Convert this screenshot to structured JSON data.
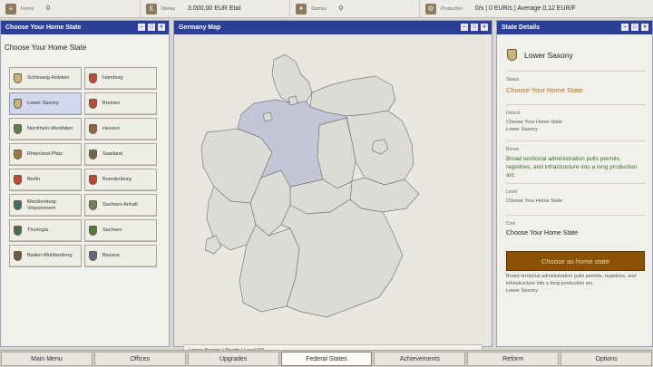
{
  "resources": [
    {
      "label": "Forms",
      "value": "0",
      "icon": "document-icon"
    },
    {
      "label": "Money",
      "value": "3.000,00 EUR Etat",
      "icon": "money-icon"
    },
    {
      "label": "Stamps",
      "value": "0",
      "icon": "stamp-icon"
    },
    {
      "label": "Production",
      "value": "0/s | 0 EUR/s | Average 0,12 EUR/F",
      "icon": "production-icon"
    }
  ],
  "left_panel": {
    "title": "Choose Your Home State",
    "heading": "Choose Your Home State",
    "states": [
      {
        "label": "Schleswig-Holstein",
        "color": "#c9b37a"
      },
      {
        "label": "Hamburg",
        "color": "#b94b3a"
      },
      {
        "label": "Lower Saxony",
        "color": "#c9b37a"
      },
      {
        "label": "Bremen",
        "color": "#b94b3a"
      },
      {
        "label": "Nordrhein-Westfalen",
        "color": "#5a7f4d"
      },
      {
        "label": "Hessen",
        "color": "#8a6a45"
      },
      {
        "label": "Rheinland-Pfalz",
        "color": "#9a7a45"
      },
      {
        "label": "Saarland",
        "color": "#6e6a4f"
      },
      {
        "label": "Berlin",
        "color": "#b94b3a"
      },
      {
        "label": "Brandenburg",
        "color": "#b94b3a"
      },
      {
        "label": "Mecklenburg-Vorpommern",
        "color": "#3d6e62"
      },
      {
        "label": "Sachsen-Anhalt",
        "color": "#7b7a58"
      },
      {
        "label": "Thuringia",
        "color": "#4d6d52"
      },
      {
        "label": "Sachsen",
        "color": "#5a7a45"
      },
      {
        "label": "Baden-Württemberg",
        "color": "#6b5b45"
      },
      {
        "label": "Bavaria",
        "color": "#5b6d7a"
      }
    ]
  },
  "center_panel": {
    "title": "Germany Map",
    "status": "Lower Saxony | Ready | Level 0/3"
  },
  "right_panel": {
    "title": "State Details",
    "state_name": "Lower Saxony",
    "status_label": "Status",
    "status_value": "Choose Your Home State",
    "unlock_label": "Unlock",
    "unlock_line1": "Choose Your Home State",
    "unlock_line2": "Lower Saxony",
    "bonus_label": "Bonus",
    "bonus_value": "Broad territorial administration pulls permits, registries, and infrastructure into a long production arc.",
    "level_label": "Level",
    "level_value": "Choose Your Home State",
    "cost_label": "Cost",
    "cost_value": "Choose Your Home State",
    "button_label": "Choose as home state",
    "footer_line1": "Broad territorial administration pulls permits, registries, and infrastructure into a long production arc.",
    "footer_line2": "Lower Saxony"
  },
  "tabs": [
    "Main Menu",
    "Offices",
    "Upgrades",
    "Federal States",
    "Achievements",
    "Reform",
    "Options"
  ],
  "active_tab": "Federal States",
  "colors": {
    "title_bar": "#2c3f96",
    "accent_orange": "#b36f17",
    "button_brown": "#8b5205",
    "bonus_green": "#3b6a2e",
    "selected_state": "#c3c6d6"
  }
}
